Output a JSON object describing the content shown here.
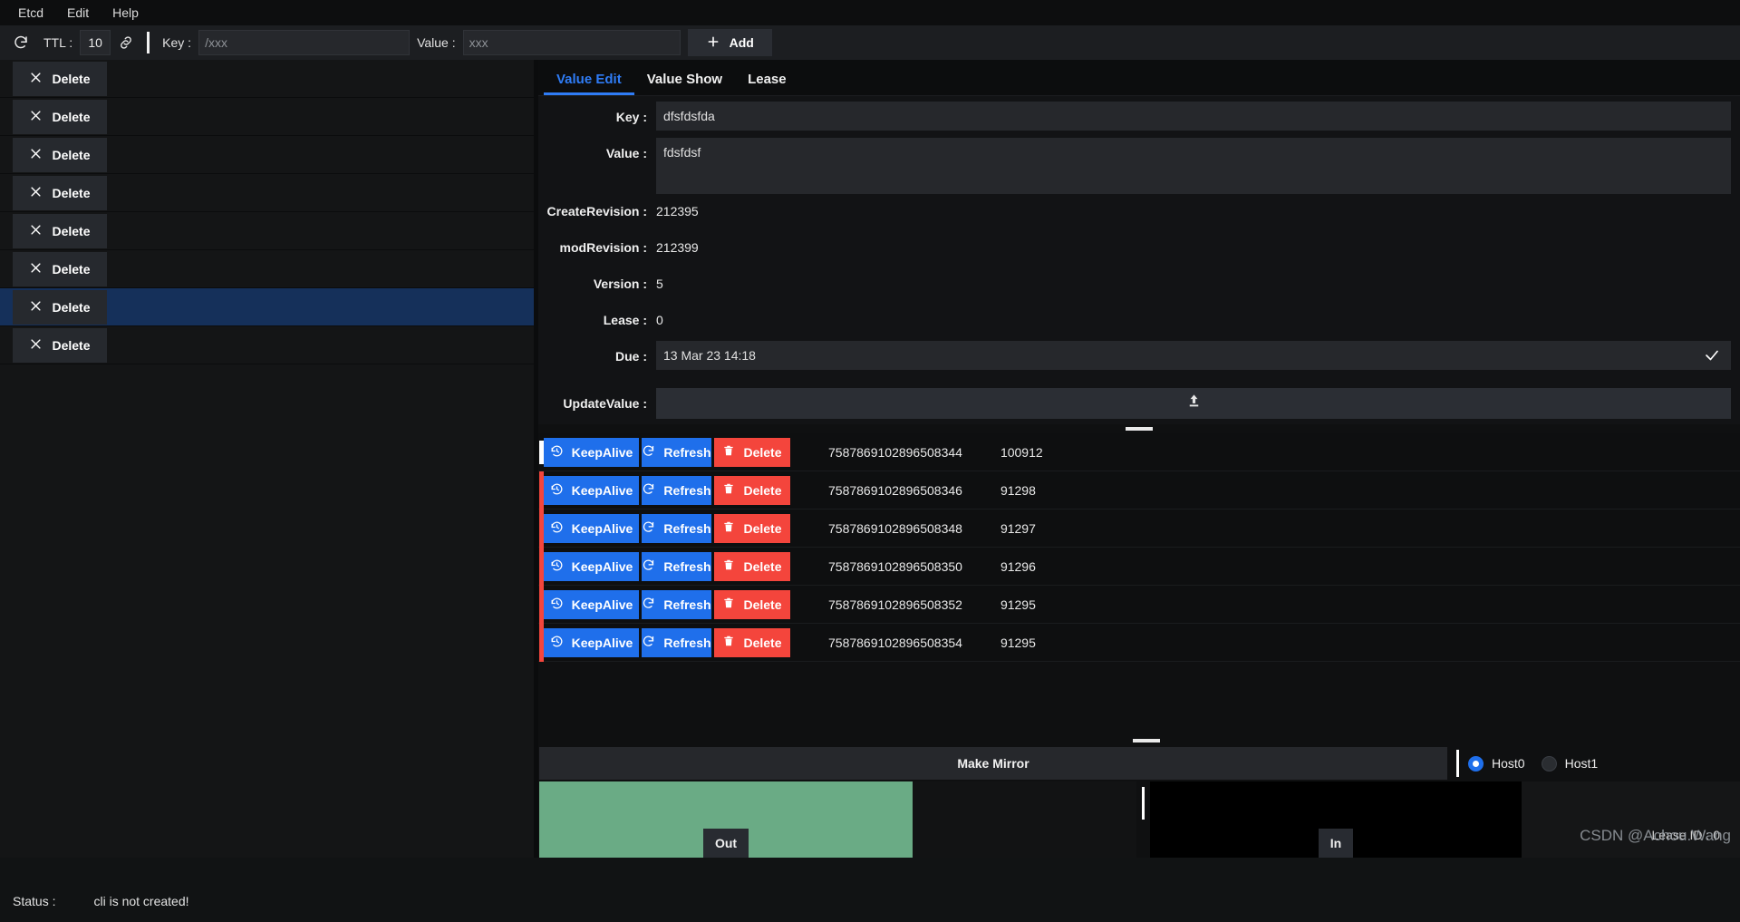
{
  "menubar": {
    "items": [
      {
        "label": "Etcd",
        "name": "menu-etcd"
      },
      {
        "label": "Edit",
        "name": "menu-edit"
      },
      {
        "label": "Help",
        "name": "menu-help"
      }
    ]
  },
  "toolbar": {
    "refresh_icon": "refresh-icon",
    "ttl_label": "TTL :",
    "ttl_value": "10",
    "link_icon": "link-icon",
    "key_label": "Key :",
    "key_value": "",
    "key_placeholder": "/xxx",
    "value_label": "Value :",
    "value_value": "",
    "value_placeholder": "xxx",
    "add_label": "Add"
  },
  "keylist": {
    "delete_label": "Delete",
    "rows": [
      {
        "key": "",
        "selected": false
      },
      {
        "key": "",
        "selected": false
      },
      {
        "key": "",
        "selected": false
      },
      {
        "key": "",
        "selected": false
      },
      {
        "key": "",
        "selected": false
      },
      {
        "key": "",
        "selected": false
      },
      {
        "key": "",
        "selected": true
      },
      {
        "key": "",
        "selected": false
      }
    ]
  },
  "tabs": [
    {
      "label": "Value Edit",
      "name": "tab-value-edit",
      "active": true
    },
    {
      "label": "Value Show",
      "name": "tab-value-show",
      "active": false
    },
    {
      "label": "Lease",
      "name": "tab-lease",
      "active": false
    }
  ],
  "form": {
    "key_label": "Key :",
    "key_value": "dfsfdsfda",
    "value_label": "Value :",
    "value_value": "fdsfdsf",
    "create_revision_label": "CreateRevision :",
    "create_revision_value": "212395",
    "mod_revision_label": "modRevision :",
    "mod_revision_value": "212399",
    "version_label": "Version :",
    "version_value": "5",
    "lease_label": "Lease :",
    "lease_value": "0",
    "due_label": "Due :",
    "due_value": "13 Mar 23 14:18",
    "confirm_icon": "check-icon",
    "update_value_label": "UpdateValue :",
    "upload_icon": "upload-icon"
  },
  "lease_table": {
    "keepalive_label": "KeepAlive",
    "refresh_label": "Refresh",
    "delete_label": "Delete",
    "keepalive_icon": "history-clock-icon",
    "refresh_icon": "refresh-icon",
    "delete_icon": "trash-icon",
    "rows": [
      {
        "lease_id": "7587869102896508344",
        "ttl": "100912"
      },
      {
        "lease_id": "7587869102896508346",
        "ttl": "91298"
      },
      {
        "lease_id": "7587869102896508348",
        "ttl": "91297"
      },
      {
        "lease_id": "7587869102896508350",
        "ttl": "91296"
      },
      {
        "lease_id": "7587869102896508352",
        "ttl": "91295"
      },
      {
        "lease_id": "7587869102896508354",
        "ttl": "91295"
      }
    ]
  },
  "mirror": {
    "button_label": "Make Mirror",
    "hosts": [
      {
        "label": "Host0",
        "selected": true
      },
      {
        "label": "Host1",
        "selected": false
      }
    ]
  },
  "io": {
    "out_label": "Out",
    "in_label": "In",
    "out_color": "#6aab85",
    "in_color": "#000000",
    "lease_id_label": "Lease ID :   0"
  },
  "status": {
    "label": "Status :",
    "message": "cli is not created!"
  },
  "watermark": {
    "text": "CSDN @Achou.Wang"
  },
  "colors": {
    "accent_blue": "#1f6feb",
    "tab_active": "#2f7cf6",
    "danger_red": "#f4453c",
    "selected_row": "#15305a",
    "out_green": "#6aab85"
  }
}
